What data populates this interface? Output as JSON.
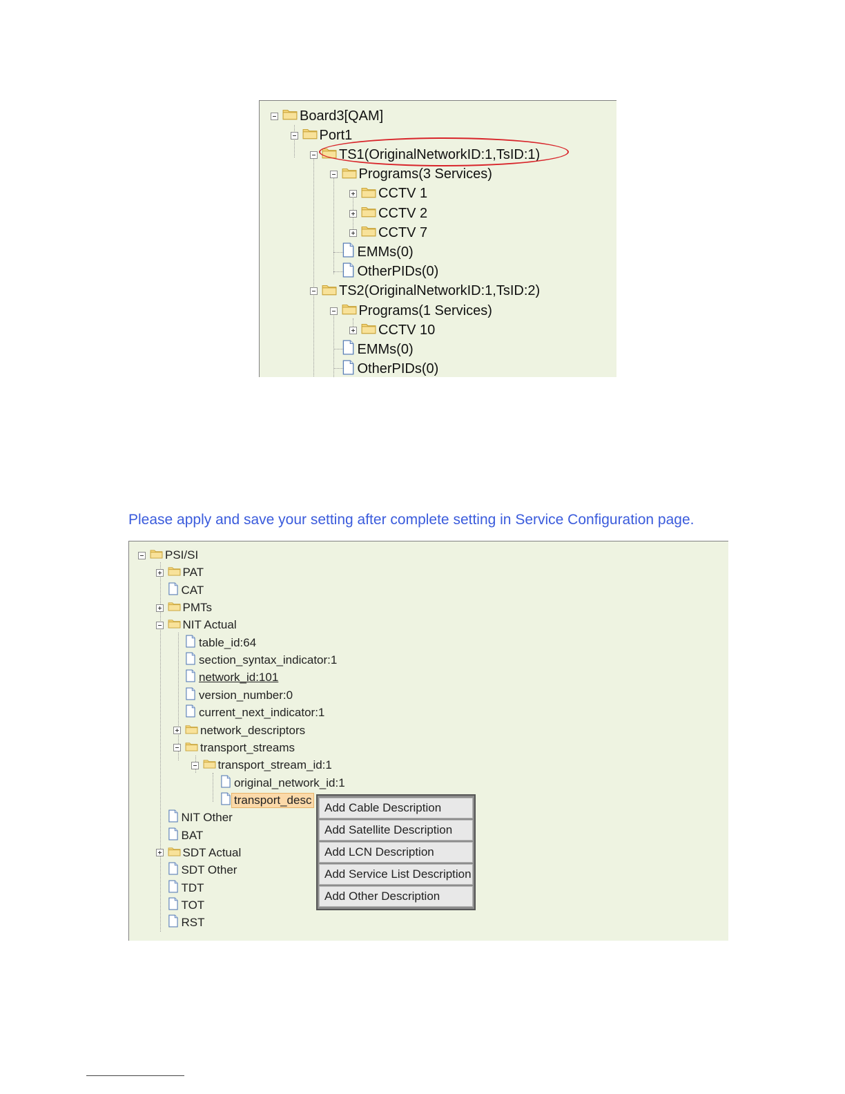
{
  "tree_top": {
    "nodes": [
      {
        "label": "Board3[QAM]",
        "state": "expanded",
        "kind": "folder"
      },
      {
        "label": "Port1",
        "state": "expanded",
        "kind": "folder"
      },
      {
        "label": "TS1(OriginalNetworkID:1,TsID:1)",
        "state": "expanded",
        "kind": "folder",
        "highlighted": true
      },
      {
        "label": "Programs(3 Services)",
        "state": "expanded",
        "kind": "folder"
      },
      {
        "label": "CCTV 1",
        "state": "collapsed",
        "kind": "folder"
      },
      {
        "label": "CCTV 2",
        "state": "collapsed",
        "kind": "folder"
      },
      {
        "label": "CCTV 7",
        "state": "collapsed",
        "kind": "folder"
      },
      {
        "label": "EMMs(0)",
        "kind": "file"
      },
      {
        "label": "OtherPIDs(0)",
        "kind": "file"
      },
      {
        "label": "TS2(OriginalNetworkID:1,TsID:2)",
        "state": "expanded",
        "kind": "folder"
      },
      {
        "label": "Programs(1 Services)",
        "state": "expanded",
        "kind": "folder"
      },
      {
        "label": "CCTV 10",
        "state": "collapsed",
        "kind": "folder"
      },
      {
        "label": "EMMs(0)",
        "kind": "file"
      },
      {
        "label": "OtherPIDs(0)",
        "kind": "file"
      }
    ],
    "highlight_color": "#d8242a"
  },
  "notice": "Please apply and save your setting after complete setting in Service Configuration page.",
  "tree_bottom": {
    "nodes": [
      {
        "label": "PSI/SI",
        "state": "expanded",
        "kind": "folder"
      },
      {
        "label": "PAT",
        "state": "collapsed",
        "kind": "folder"
      },
      {
        "label": "CAT",
        "kind": "file"
      },
      {
        "label": "PMTs",
        "state": "collapsed",
        "kind": "folder"
      },
      {
        "label": "NIT Actual",
        "state": "expanded",
        "kind": "folder"
      },
      {
        "label": "table_id:64",
        "kind": "file"
      },
      {
        "label": "section_syntax_indicator:1",
        "kind": "file"
      },
      {
        "label": "network_id:101",
        "kind": "file",
        "underlined": true
      },
      {
        "label": "version_number:0",
        "kind": "file"
      },
      {
        "label": "current_next_indicator:1",
        "kind": "file"
      },
      {
        "label": "network_descriptors",
        "state": "collapsed",
        "kind": "folder"
      },
      {
        "label": "transport_streams",
        "state": "expanded",
        "kind": "folder"
      },
      {
        "label": "transport_stream_id:1",
        "state": "expanded",
        "kind": "folder"
      },
      {
        "label": "original_network_id:1",
        "kind": "file"
      },
      {
        "label": "transport_desc",
        "kind": "file",
        "selected": true
      },
      {
        "label": "NIT Other",
        "kind": "file"
      },
      {
        "label": "BAT",
        "kind": "file"
      },
      {
        "label": "SDT Actual",
        "state": "collapsed",
        "kind": "folder"
      },
      {
        "label": "SDT Other",
        "kind": "file"
      },
      {
        "label": "TDT",
        "kind": "file"
      },
      {
        "label": "TOT",
        "kind": "file"
      },
      {
        "label": "RST",
        "kind": "file"
      }
    ]
  },
  "context_menu": {
    "items": [
      "Add Cable Description",
      "Add Satellite Description",
      "Add LCN Description",
      "Add Service List Description",
      "Add Other Description"
    ]
  },
  "colors": {
    "panel_bg": "#eef3e1",
    "notice_text": "#3a5bdc",
    "selection_bg": "#fbd9a9",
    "folder": "#f4d57a"
  }
}
